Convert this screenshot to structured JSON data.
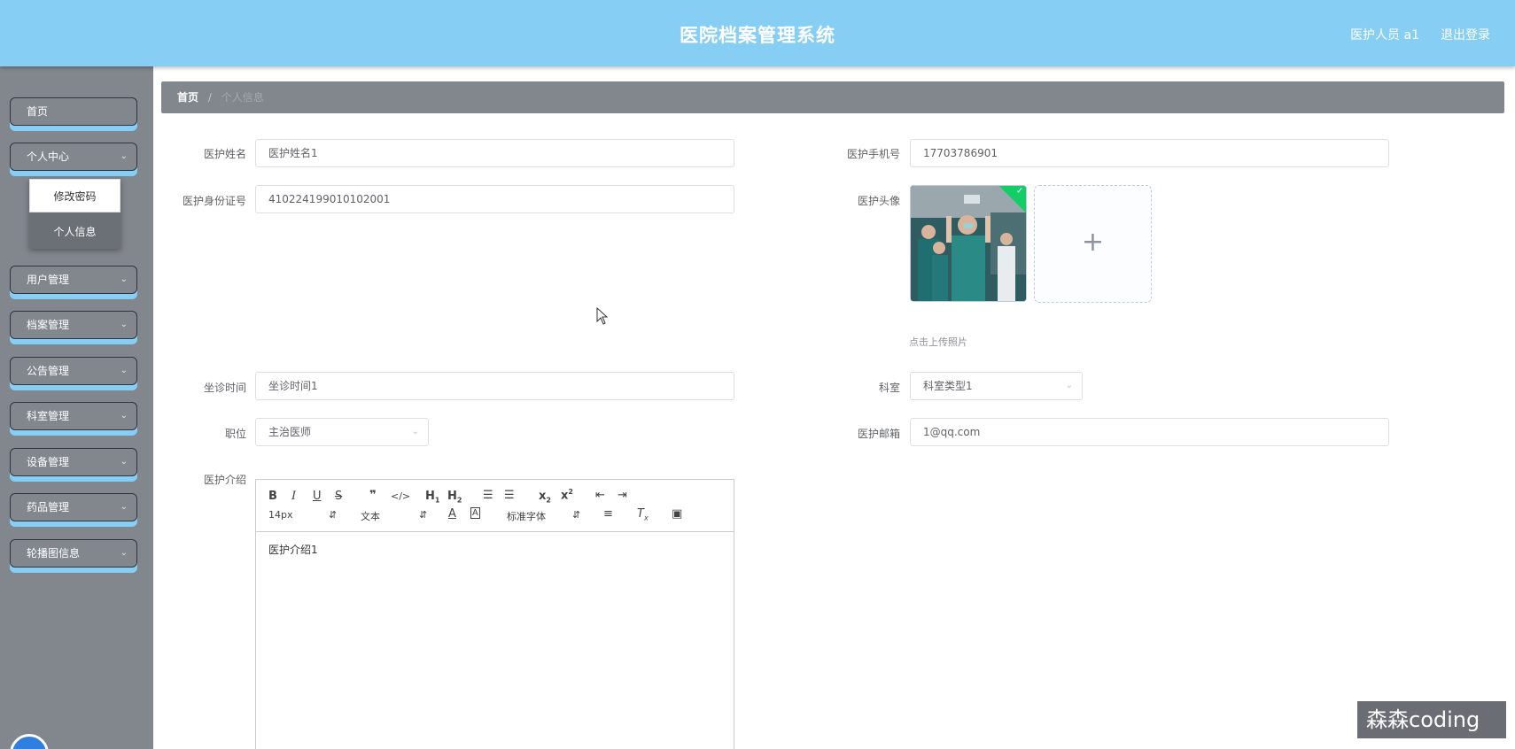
{
  "header": {
    "title": "医院档案管理系统",
    "user_label": "医护人员 a1",
    "logout_label": "退出登录"
  },
  "sidebar": {
    "items": [
      {
        "label": "首页"
      },
      {
        "label": "个人中心"
      },
      {
        "label": "用户管理"
      },
      {
        "label": "档案管理"
      },
      {
        "label": "公告管理"
      },
      {
        "label": "科室管理"
      },
      {
        "label": "设备管理"
      },
      {
        "label": "药品管理"
      },
      {
        "label": "轮播图信息"
      }
    ],
    "submenu": [
      {
        "label": "修改密码"
      },
      {
        "label": "个人信息"
      }
    ]
  },
  "breadcrumb": {
    "home": "首页",
    "separator": "/",
    "current": "个人信息"
  },
  "form": {
    "name": {
      "label": "医护姓名",
      "value": "医护姓名1"
    },
    "phone": {
      "label": "医护手机号",
      "value": "17703786901"
    },
    "id_card": {
      "label": "医护身份证号",
      "value": "410224199010102001"
    },
    "avatar": {
      "label": "医护头像",
      "upload_tip": "点击上传照片",
      "upload_icon": "+"
    },
    "schedule": {
      "label": "坐诊时间",
      "value": "坐诊时间1"
    },
    "department": {
      "label": "科室",
      "value": "科室类型1"
    },
    "position": {
      "label": "职位",
      "value": "主治医师"
    },
    "email": {
      "label": "医护邮箱",
      "value": "1@qq.com"
    },
    "intro": {
      "label": "医护介绍",
      "value": "医护介绍1"
    }
  },
  "editor_toolbar": {
    "size_select": "14px",
    "header_select": "文本",
    "font_select": "标准字体"
  },
  "watermark": "森森coding",
  "colors": {
    "header_bg": "#87cef5",
    "sidebar_bg": "#82868d",
    "menu_underline": "#87cef5",
    "success_badge": "#13ce66"
  }
}
